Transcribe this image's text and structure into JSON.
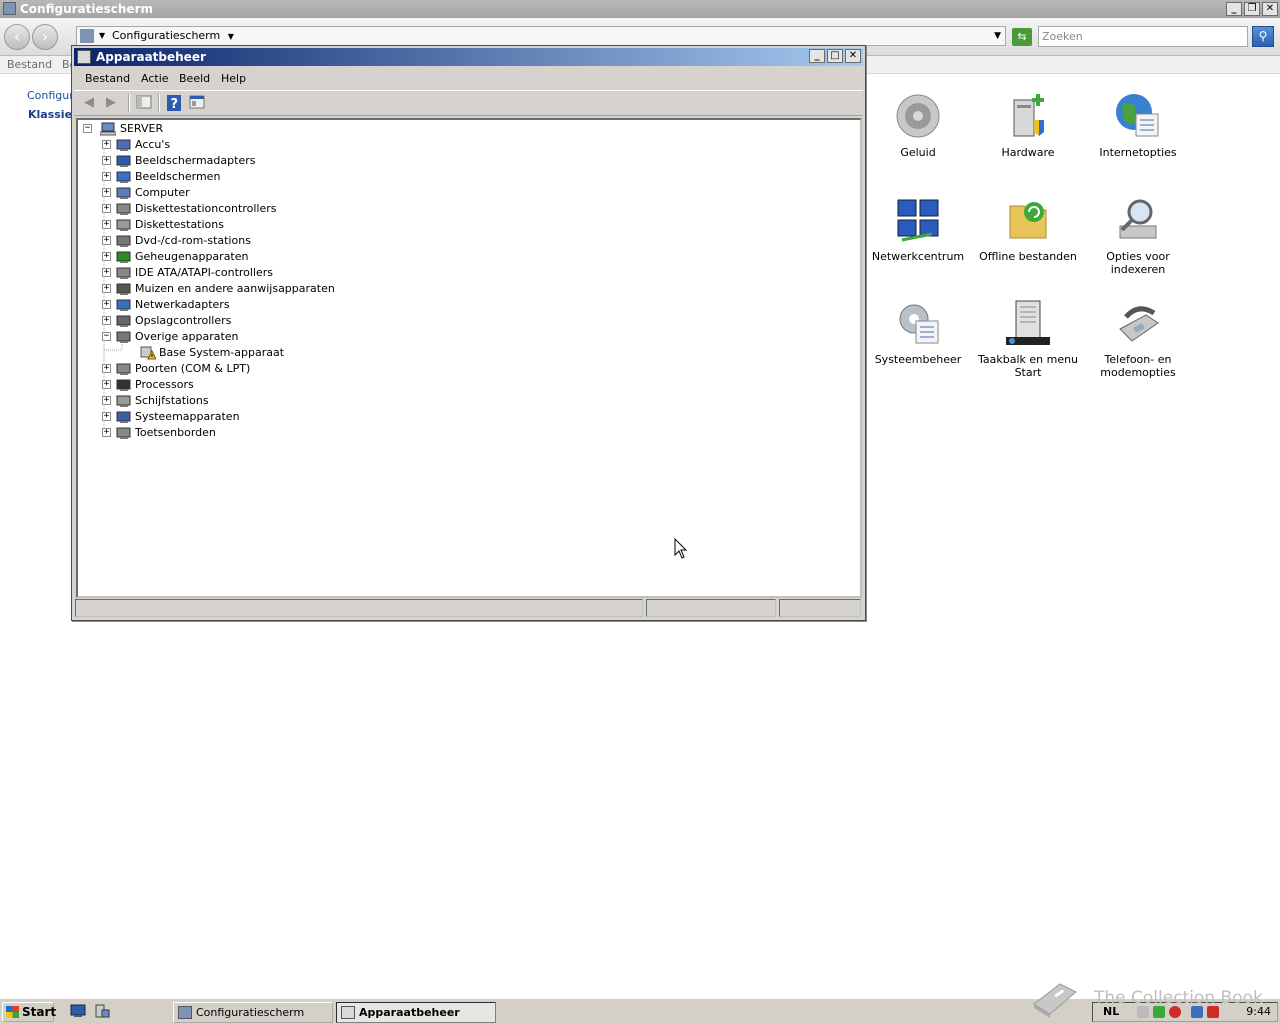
{
  "background_window": {
    "title": "Configuratiescherm",
    "address": "Configuratiescherm",
    "search_placeholder": "Zoeken",
    "menu": [
      "Bestand",
      "Be"
    ],
    "left_nav": {
      "crumb": "Configura",
      "classic": "Klassiek"
    },
    "items": [
      {
        "label": "Geluid",
        "icon": "speaker-icon"
      },
      {
        "label": "Hardware",
        "icon": "hardware-icon"
      },
      {
        "label": "Internetopties",
        "icon": "internet-options-icon"
      },
      {
        "label": "Netwerkcentrum",
        "icon": "network-center-icon"
      },
      {
        "label": "Offline bestanden",
        "icon": "offline-files-icon"
      },
      {
        "label": "Opties voor indexeren",
        "icon": "indexing-options-icon"
      },
      {
        "label": "Systeembeheer",
        "icon": "admin-tools-icon"
      },
      {
        "label": "Taakbalk en menu Start",
        "icon": "taskbar-start-icon"
      },
      {
        "label": "Telefoon- en modemopties",
        "icon": "phone-modem-icon"
      }
    ]
  },
  "device_manager": {
    "title": "Apparaatbeheer",
    "menu": [
      "Bestand",
      "Actie",
      "Beeld",
      "Help"
    ],
    "root": "SERVER",
    "categories": [
      {
        "label": "Accu's",
        "expanded": false
      },
      {
        "label": "Beeldschermadapters",
        "expanded": false
      },
      {
        "label": "Beeldschermen",
        "expanded": false
      },
      {
        "label": "Computer",
        "expanded": false
      },
      {
        "label": "Diskettestationcontrollers",
        "expanded": false
      },
      {
        "label": "Diskettestations",
        "expanded": false
      },
      {
        "label": "Dvd-/cd-rom-stations",
        "expanded": false
      },
      {
        "label": "Geheugenapparaten",
        "expanded": false
      },
      {
        "label": "IDE ATA/ATAPI-controllers",
        "expanded": false
      },
      {
        "label": "Muizen en andere aanwijsapparaten",
        "expanded": false
      },
      {
        "label": "Netwerkadapters",
        "expanded": false
      },
      {
        "label": "Opslagcontrollers",
        "expanded": false
      },
      {
        "label": "Overige apparaten",
        "expanded": true,
        "children": [
          "Base System-apparaat"
        ]
      },
      {
        "label": "Poorten (COM & LPT)",
        "expanded": false
      },
      {
        "label": "Processors",
        "expanded": false
      },
      {
        "label": "Schijfstations",
        "expanded": false
      },
      {
        "label": "Systeemapparaten",
        "expanded": false
      },
      {
        "label": "Toetsenborden",
        "expanded": false
      }
    ]
  },
  "taskbar": {
    "start_label": "Start",
    "tasks": [
      "Configuratiescherm",
      "Apparaatbeheer"
    ],
    "language": "NL",
    "clock": "9:44"
  },
  "watermark": "The Collection Book"
}
